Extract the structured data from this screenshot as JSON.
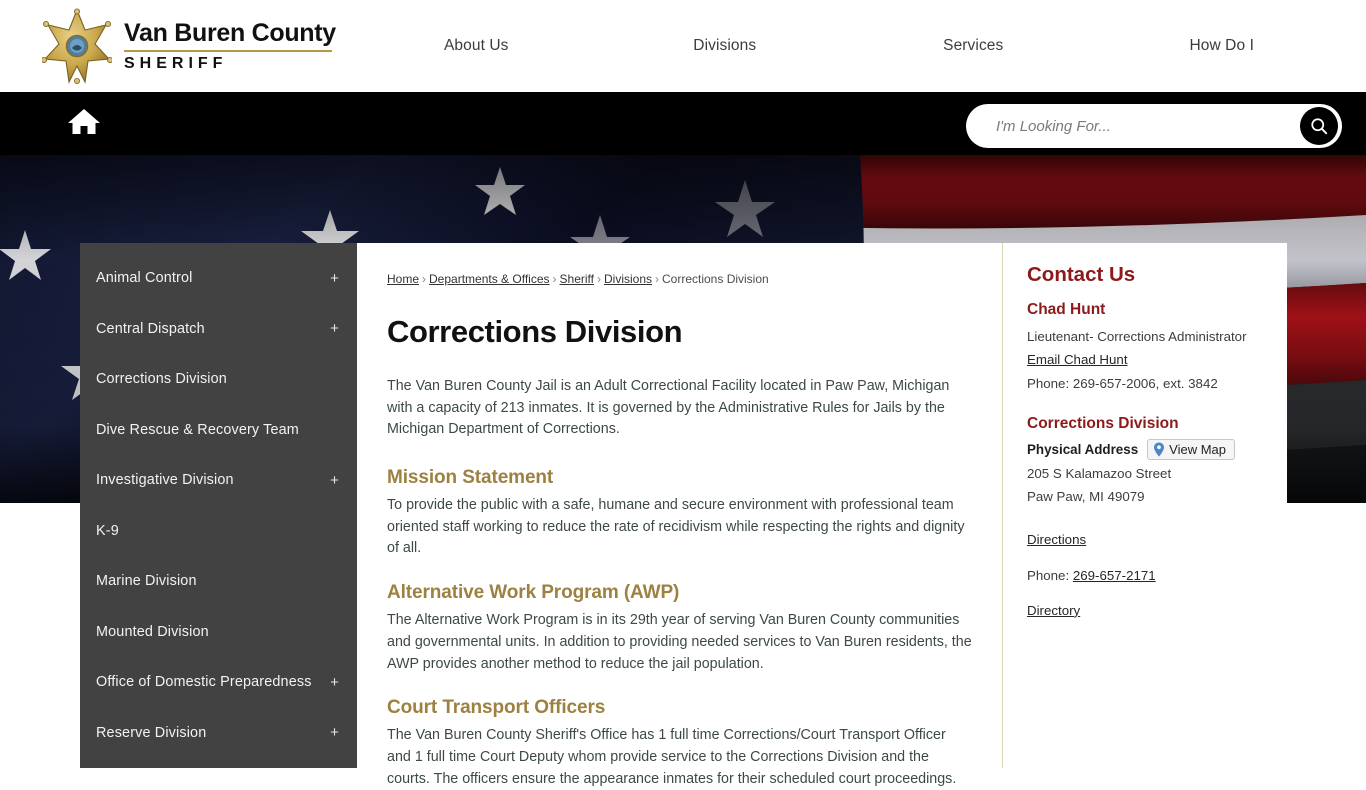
{
  "header": {
    "logo_icon": "sheriff-star-badge-icon",
    "brand_title": "Van Buren County",
    "brand_subtitle": "SHERIFF",
    "nav": [
      {
        "label": "About Us"
      },
      {
        "label": "Divisions"
      },
      {
        "label": "Services"
      },
      {
        "label": "How Do I"
      }
    ]
  },
  "utility_bar": {
    "home_icon": "home-icon",
    "search_placeholder": "I'm Looking For...",
    "search_value": "",
    "search_icon": "search-icon"
  },
  "banner": {
    "image_description": "american-flag-banner"
  },
  "sidebar": {
    "items": [
      {
        "label": "Animal Control",
        "expandable": "+"
      },
      {
        "label": "Central Dispatch",
        "expandable": "+"
      },
      {
        "label": "Corrections Division",
        "expandable": ""
      },
      {
        "label": "Dive Rescue & Recovery Team",
        "expandable": ""
      },
      {
        "label": "Investigative Division",
        "expandable": "+"
      },
      {
        "label": "K-9",
        "expandable": ""
      },
      {
        "label": "Marine Division",
        "expandable": ""
      },
      {
        "label": "Mounted Division",
        "expandable": ""
      },
      {
        "label": "Office of Domestic Preparedness",
        "expandable": "+"
      },
      {
        "label": "Reserve Division",
        "expandable": "+"
      }
    ]
  },
  "breadcrumb": {
    "items": [
      {
        "label": "Home",
        "link": true
      },
      {
        "label": "Departments & Offices",
        "link": true
      },
      {
        "label": "Sheriff",
        "link": true
      },
      {
        "label": "Divisions",
        "link": true
      },
      {
        "label": "Corrections Division",
        "link": false
      }
    ],
    "separator": "›"
  },
  "main": {
    "title": "Corrections Division",
    "intro": "The Van Buren County Jail is an Adult Correctional Facility located in Paw Paw, Michigan with a capacity of 213 inmates. It is governed by the Administrative Rules for Jails by the Michigan Department of Corrections.",
    "sections": [
      {
        "heading": "Mission Statement",
        "body": "To provide the public with a safe, humane and secure environment with professional team oriented staff working to reduce the rate of recidivism while respecting the rights and dignity of all."
      },
      {
        "heading": "Alternative Work Program (AWP)",
        "body": "The Alternative Work Program is in its 29th year of serving Van Buren County communities and governmental units. In addition to providing needed services to Van Buren residents, the AWP provides another method to reduce the jail population."
      },
      {
        "heading": "Court Transport Officers",
        "body": "The Van Buren County Sheriff's Office has 1 full time Corrections/Court Transport Officer and 1 full time Court Deputy whom provide service to the Corrections Division and the courts. The officers ensure the appearance inmates for their scheduled court proceedings."
      }
    ]
  },
  "contact": {
    "title": "Contact Us",
    "person_name": "Chad Hunt",
    "person_role": "Lieutenant- Corrections Administrator",
    "email_link": "Email Chad Hunt",
    "person_phone": "Phone: 269-657-2006, ext. 3842",
    "division_title": "Corrections Division",
    "address_label": "Physical Address",
    "view_map_label": "View Map",
    "view_map_icon": "map-pin-icon",
    "address_line1": "205 S Kalamazoo Street",
    "address_line2": "Paw Paw, MI 49079",
    "directions_link": "Directions",
    "phone_prefix": "Phone: ",
    "phone_number": "269-657-2171",
    "directory_link": "Directory"
  },
  "colors": {
    "accent_gold": "#9c8141",
    "accent_red": "#8d1a1a",
    "sidebar_bg": "#424242",
    "bar_black": "#000000"
  }
}
